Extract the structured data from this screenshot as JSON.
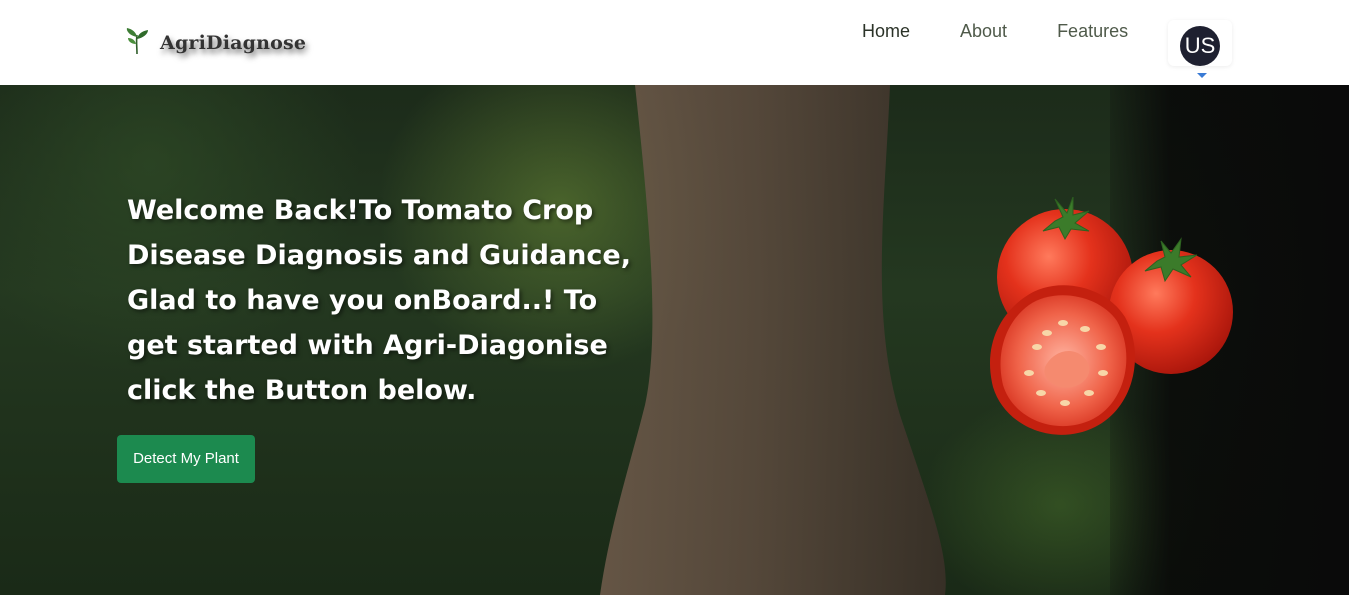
{
  "brand": {
    "name": "AgriDiagnose",
    "icon": "leaf-icon"
  },
  "nav": {
    "items": [
      {
        "label": "Home",
        "active": true
      },
      {
        "label": "About",
        "active": false
      },
      {
        "label": "Features",
        "active": false
      }
    ],
    "profile": {
      "initials": "US",
      "icon": "chevron-down-icon"
    }
  },
  "hero": {
    "heading": "Welcome Back!To Tomato Crop Disease Diagnosis and Guidance, Glad to have you onBoard..! To get started with Agri-Diagonise click the Button below.",
    "cta_label": "Detect My Plant"
  },
  "colors": {
    "accent": "#1c8a4f",
    "avatar_bg": "#1e2030",
    "caret": "#3a7bd5"
  }
}
